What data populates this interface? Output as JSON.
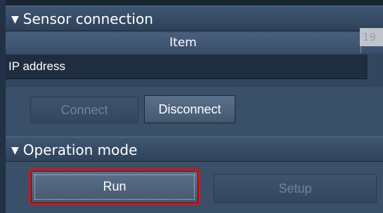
{
  "sensor_connection": {
    "title": "Sensor connection",
    "table": {
      "header_item": "Item",
      "rows": [
        {
          "label": "IP address",
          "value": "19"
        }
      ]
    },
    "connect_label": "Connect",
    "disconnect_label": "Disconnect"
  },
  "operation_mode": {
    "title": "Operation mode",
    "run_label": "Run",
    "setup_label": "Setup"
  },
  "icons": {
    "expand": "▼"
  },
  "colors": {
    "highlight": "#e01010",
    "panel": "#3a4f68",
    "row_bg": "#1f2d40"
  }
}
